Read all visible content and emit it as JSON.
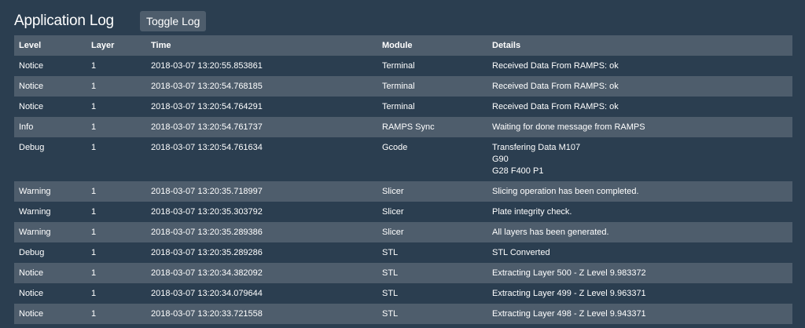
{
  "header": {
    "title": "Application Log",
    "toggle_label": "Toggle Log"
  },
  "table": {
    "columns": [
      "Level",
      "Layer",
      "Time",
      "Module",
      "Details"
    ],
    "rows": [
      {
        "level": "Notice",
        "layer": "1",
        "time": "2018-03-07 13:20:55.853861",
        "module": "Terminal",
        "details": [
          "Received Data From RAMPS: ok"
        ]
      },
      {
        "level": "Notice",
        "layer": "1",
        "time": "2018-03-07 13:20:54.768185",
        "module": "Terminal",
        "details": [
          "Received Data From RAMPS: ok"
        ]
      },
      {
        "level": "Notice",
        "layer": "1",
        "time": "2018-03-07 13:20:54.764291",
        "module": "Terminal",
        "details": [
          "Received Data From RAMPS: ok"
        ]
      },
      {
        "level": "Info",
        "layer": "1",
        "time": "2018-03-07 13:20:54.761737",
        "module": "RAMPS Sync",
        "details": [
          "Waiting for done message from RAMPS"
        ]
      },
      {
        "level": "Debug",
        "layer": "1",
        "time": "2018-03-07 13:20:54.761634",
        "module": "Gcode",
        "details": [
          "Transfering Data M107",
          "G90",
          "G28 F400 P1"
        ]
      },
      {
        "level": "Warning",
        "layer": "1",
        "time": "2018-03-07 13:20:35.718997",
        "module": "Slicer",
        "details": [
          "Slicing operation has been completed."
        ]
      },
      {
        "level": "Warning",
        "layer": "1",
        "time": "2018-03-07 13:20:35.303792",
        "module": "Slicer",
        "details": [
          "Plate integrity check."
        ]
      },
      {
        "level": "Warning",
        "layer": "1",
        "time": "2018-03-07 13:20:35.289386",
        "module": "Slicer",
        "details": [
          "All layers has been generated."
        ]
      },
      {
        "level": "Debug",
        "layer": "1",
        "time": "2018-03-07 13:20:35.289286",
        "module": "STL",
        "details": [
          "STL Converted"
        ]
      },
      {
        "level": "Notice",
        "layer": "1",
        "time": "2018-03-07 13:20:34.382092",
        "module": "STL",
        "details": [
          "Extracting Layer 500 - Z Level 9.983372"
        ]
      },
      {
        "level": "Notice",
        "layer": "1",
        "time": "2018-03-07 13:20:34.079644",
        "module": "STL",
        "details": [
          "Extracting Layer 499 - Z Level 9.963371"
        ]
      },
      {
        "level": "Notice",
        "layer": "1",
        "time": "2018-03-07 13:20:33.721558",
        "module": "STL",
        "details": [
          "Extracting Layer 498 - Z Level 9.943371"
        ]
      }
    ]
  },
  "colors": {
    "background": "#2b3e50",
    "row_alt": "#4e5d6c",
    "text": "#ffffff"
  }
}
